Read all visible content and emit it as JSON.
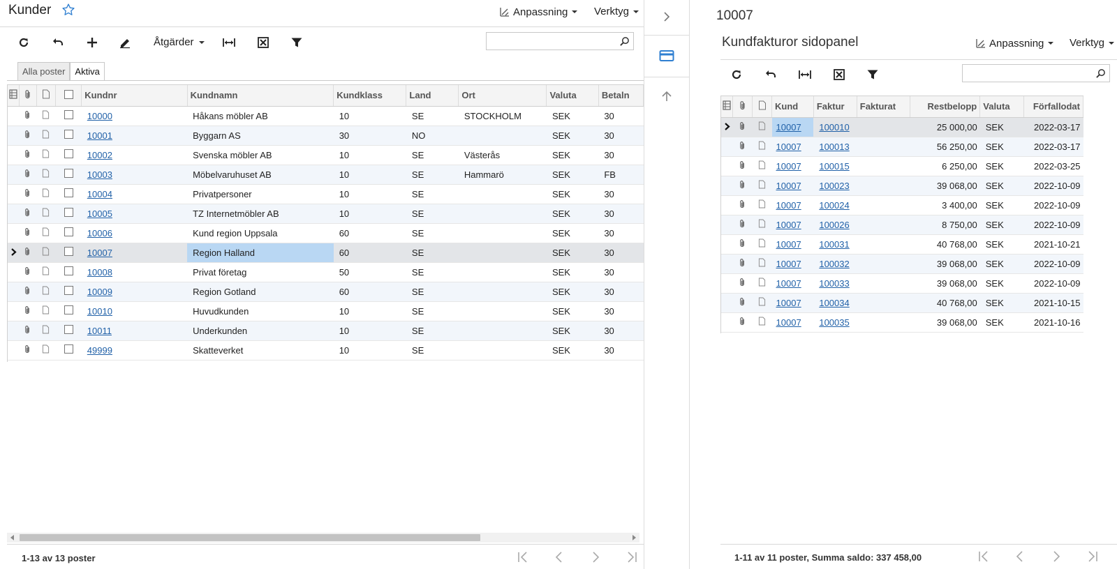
{
  "left": {
    "title": "Kunder",
    "menus": {
      "customize": "Anpassning",
      "tools": "Verktyg"
    },
    "toolbar": {
      "actions": "Åtgärder"
    },
    "search_placeholder": "",
    "tabs": [
      "Alla poster",
      "Aktiva"
    ],
    "columns": [
      "Kundnr",
      "Kundnamn",
      "Kundklass",
      "Land",
      "Ort",
      "Valuta",
      "Betaln"
    ],
    "rows": [
      [
        "10000",
        "Håkans möbler AB",
        "10",
        "SE",
        "STOCKHOLM",
        "SEK",
        "30"
      ],
      [
        "10001",
        "Byggarn AS",
        "30",
        "NO",
        "",
        "SEK",
        "30"
      ],
      [
        "10002",
        "Svenska möbler AB",
        "10",
        "SE",
        "Västerås",
        "SEK",
        "30"
      ],
      [
        "10003",
        "Möbelvaruhuset AB",
        "10",
        "SE",
        "Hammarö",
        "SEK",
        "FB"
      ],
      [
        "10004",
        "Privatpersoner",
        "10",
        "SE",
        "",
        "SEK",
        "30"
      ],
      [
        "10005",
        "TZ Internetmöbler AB",
        "10",
        "SE",
        "",
        "SEK",
        "30"
      ],
      [
        "10006",
        "Kund region Uppsala",
        "60",
        "SE",
        "",
        "SEK",
        "30"
      ],
      [
        "10007",
        "Region Halland",
        "60",
        "SE",
        "",
        "SEK",
        "30"
      ],
      [
        "10008",
        "Privat företag",
        "50",
        "SE",
        "",
        "SEK",
        "30"
      ],
      [
        "10009",
        "Region Gotland",
        "60",
        "SE",
        "",
        "SEK",
        "30"
      ],
      [
        "10010",
        "Huvudkunden",
        "10",
        "SE",
        "",
        "SEK",
        "30"
      ],
      [
        "10011",
        "Underkunden",
        "10",
        "SE",
        "",
        "SEK",
        "30"
      ],
      [
        "49999",
        "Skatteverket",
        "10",
        "SE",
        "",
        "SEK",
        "30"
      ]
    ],
    "selected_row": 7,
    "footer": "1-13 av 13 poster"
  },
  "right": {
    "record_id": "10007",
    "title": "Kundfakturor sidopanel",
    "menus": {
      "customize": "Anpassning",
      "tools": "Verktyg"
    },
    "search_placeholder": "",
    "columns": [
      "Kund",
      "Faktur",
      "Fakturat",
      "Restbelopp",
      "Valuta",
      "Förfallodat"
    ],
    "rows": [
      [
        "10007",
        "100010",
        "",
        "25 000,00",
        "SEK",
        "2022-03-17"
      ],
      [
        "10007",
        "100013",
        "",
        "56 250,00",
        "SEK",
        "2022-03-17"
      ],
      [
        "10007",
        "100015",
        "",
        "6 250,00",
        "SEK",
        "2022-03-25"
      ],
      [
        "10007",
        "100023",
        "",
        "39 068,00",
        "SEK",
        "2022-10-09"
      ],
      [
        "10007",
        "100024",
        "",
        "3 400,00",
        "SEK",
        "2022-10-09"
      ],
      [
        "10007",
        "100026",
        "",
        "8 750,00",
        "SEK",
        "2022-10-09"
      ],
      [
        "10007",
        "100031",
        "",
        "40 768,00",
        "SEK",
        "2021-10-21"
      ],
      [
        "10007",
        "100032",
        "",
        "39 068,00",
        "SEK",
        "2022-10-09"
      ],
      [
        "10007",
        "100033",
        "",
        "39 068,00",
        "SEK",
        "2022-10-09"
      ],
      [
        "10007",
        "100034",
        "",
        "40 768,00",
        "SEK",
        "2021-10-15"
      ],
      [
        "10007",
        "100035",
        "",
        "39 068,00",
        "SEK",
        "2021-10-16"
      ]
    ],
    "selected_row": 0,
    "footer": "1-11 av 11 poster, Summa saldo: 337 458,00"
  },
  "colors": {
    "link": "#2161a8",
    "accent": "#2f7fd1",
    "selected_cell": "#b9d7f3",
    "alt_row": "#f2f6fb"
  }
}
